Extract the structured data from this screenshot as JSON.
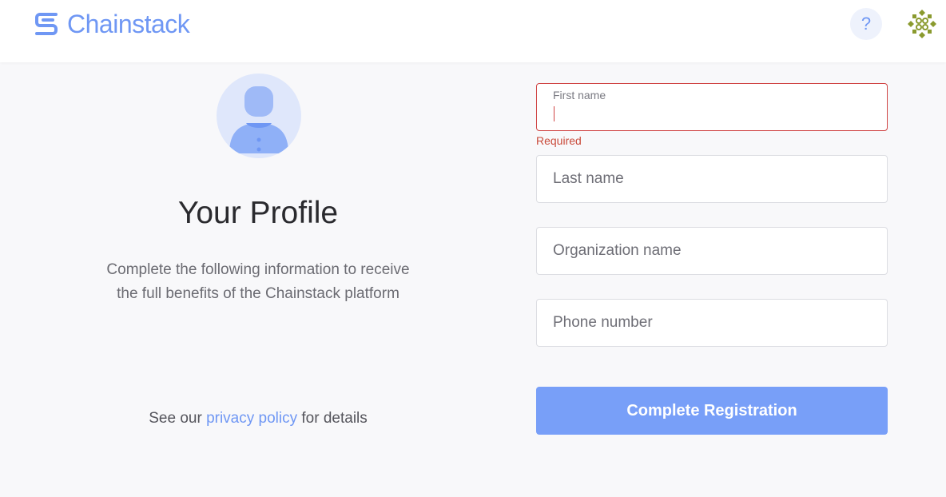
{
  "header": {
    "brand": "Chainstack",
    "help_label": "?",
    "icons": {
      "logo": "chainstack-logo-icon",
      "help": "question-mark-icon",
      "avatar": "user-identicon"
    },
    "colors": {
      "brand": "#6f97f4",
      "identicon": "#8a9a2e"
    }
  },
  "profile": {
    "title": "Your Profile",
    "description": "Complete the following information to receive the full benefits of the Chainstack platform",
    "privacy_prefix": "See our ",
    "privacy_link": "privacy policy",
    "privacy_suffix": " for details"
  },
  "form": {
    "first_name": {
      "label": "First name",
      "value": "",
      "error": "Required"
    },
    "last_name": {
      "placeholder": "Last name",
      "value": ""
    },
    "organization": {
      "placeholder": "Organization name",
      "value": ""
    },
    "phone": {
      "placeholder": "Phone number",
      "value": ""
    },
    "submit_label": "Complete Registration"
  },
  "colors": {
    "accent": "#789ff8",
    "error": "#d04545",
    "background": "#f8f8fa"
  }
}
